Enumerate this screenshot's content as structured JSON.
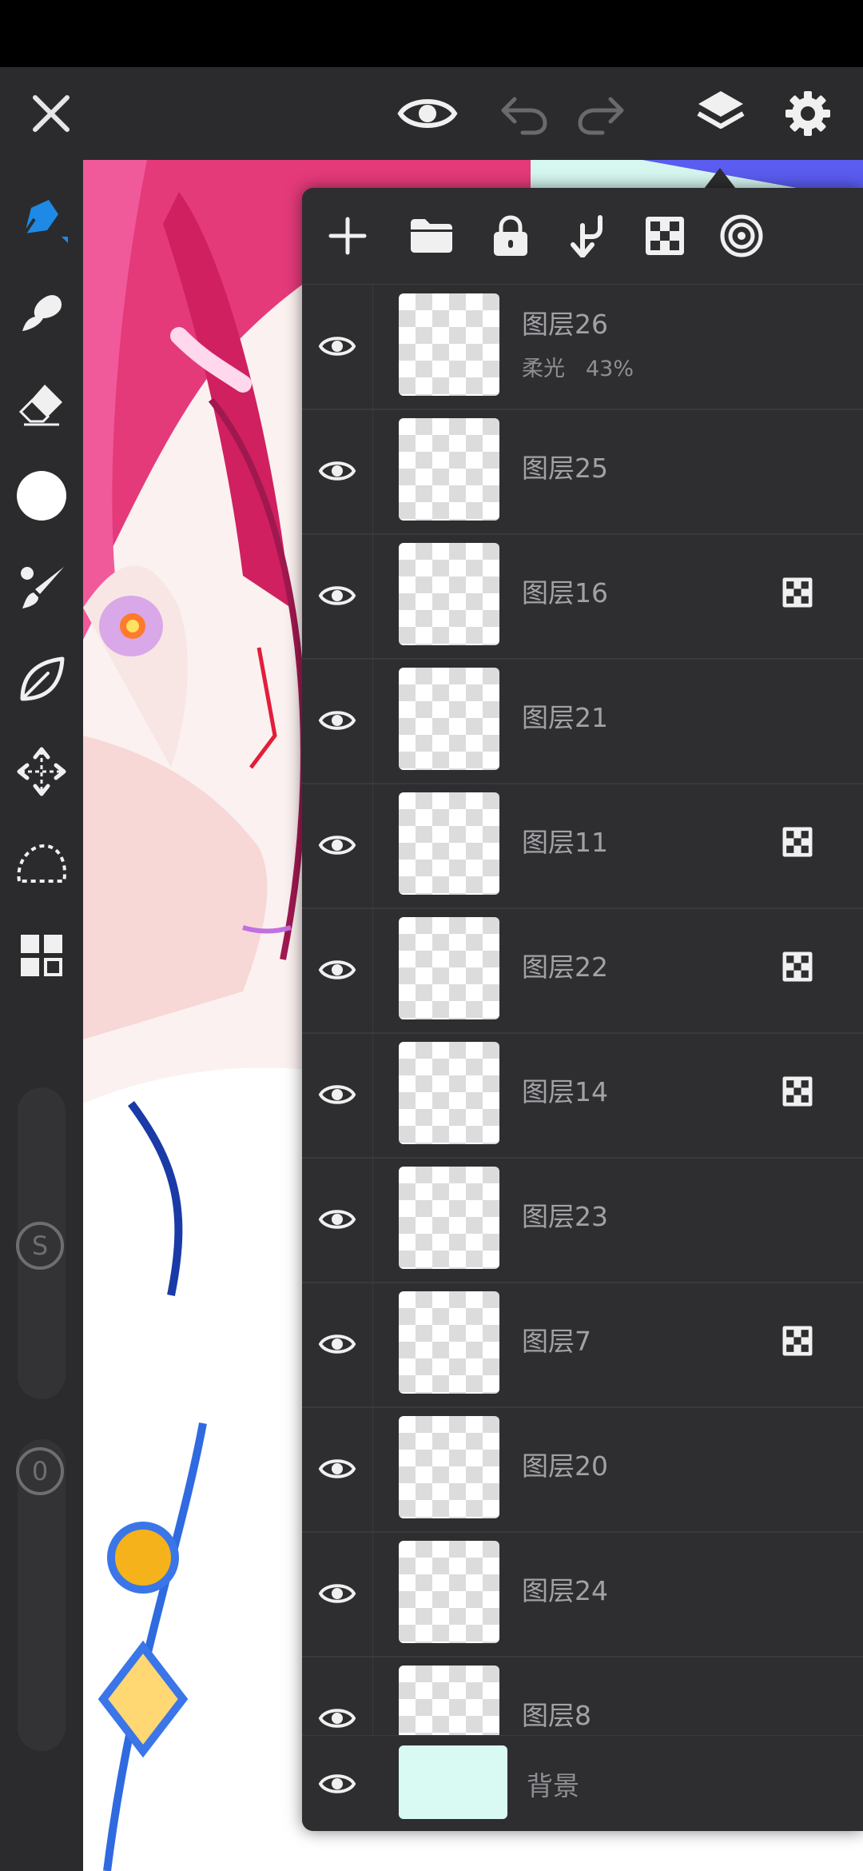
{
  "top_toolbar": {
    "icons": [
      "close-icon",
      "eye-icon",
      "undo-icon",
      "redo-icon",
      "layers-icon",
      "gear-icon"
    ]
  },
  "left_toolbar": {
    "tools": [
      "pen-icon",
      "smudge-icon",
      "eraser-icon",
      "color-circle-icon",
      "brush-icon",
      "leaf-icon",
      "move-icon",
      "lasso-icon",
      "grid-icon"
    ],
    "size_slider_label": "S",
    "opacity_slider_label": "0"
  },
  "colors": {
    "accent": "#1e8ae6",
    "panel_bg": "#2e2e31",
    "toolbar_bg": "#2b2b2d",
    "background_layer_color": "#d8faf2"
  },
  "layers_panel": {
    "toolbar_icons": [
      "add-icon",
      "folder-icon",
      "lock-icon",
      "merge-down-icon",
      "clipping-checker-icon",
      "target-icon"
    ],
    "layers": [
      {
        "name": "图层26",
        "mode": "柔光",
        "opacity": "43%",
        "clip": false
      },
      {
        "name": "图层25",
        "clip": false
      },
      {
        "name": "图层16",
        "clip": true
      },
      {
        "name": "图层21",
        "clip": false
      },
      {
        "name": "图层11",
        "clip": true
      },
      {
        "name": "图层22",
        "clip": true
      },
      {
        "name": "图层14",
        "clip": true
      },
      {
        "name": "图层23",
        "clip": false
      },
      {
        "name": "图层7",
        "clip": true
      },
      {
        "name": "图层20",
        "clip": false
      },
      {
        "name": "图层24",
        "clip": false
      },
      {
        "name": "图层8",
        "clip": false
      }
    ],
    "background": {
      "name": "背景"
    }
  }
}
